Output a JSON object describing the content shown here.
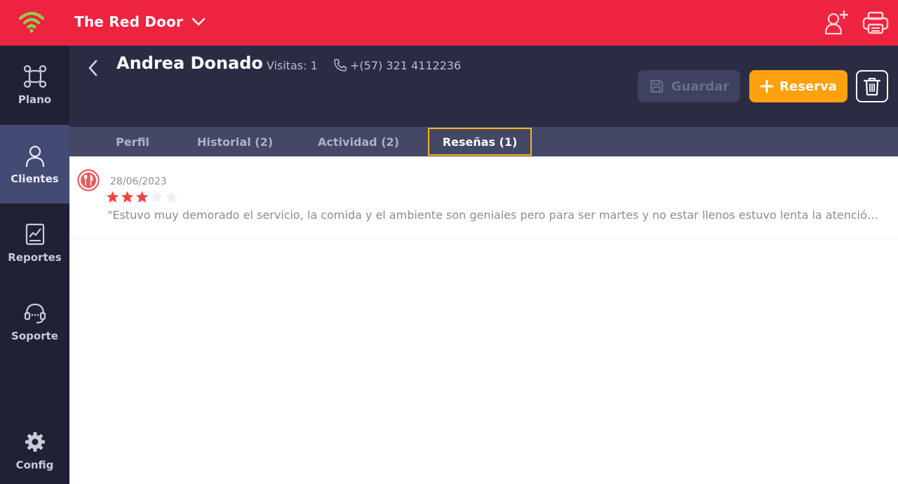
{
  "topbar": {
    "venue_name": "The Red Door",
    "icons": [
      "wifi-icon",
      "chevron-down-icon",
      "add-user-icon",
      "printer-icon"
    ],
    "color": "#ee2340"
  },
  "sidebar": {
    "items": [
      {
        "label": "Plano",
        "icon": "floor-plan-icon"
      },
      {
        "label": "Clientes",
        "icon": "user-icon",
        "active": true
      },
      {
        "label": "Reportes",
        "icon": "report-chart-icon"
      },
      {
        "label": "Soporte",
        "icon": "headset-icon"
      },
      {
        "label": "Config",
        "icon": "gear-icon"
      }
    ]
  },
  "client": {
    "name": "Andrea Donado",
    "visits": "- Visitas: 1",
    "phone": "+(57) 321 4112236"
  },
  "actions": {
    "save_label": "Guardar",
    "reserve_label": "Reserva",
    "reserve_color": "#ffa10e"
  },
  "tabs": [
    {
      "label": "Perfil"
    },
    {
      "label": "Historial (2)"
    },
    {
      "label": "Actividad (2)"
    },
    {
      "label": "Reseñas (1)",
      "active": true
    }
  ],
  "reviews": [
    {
      "date": "28/06/2023",
      "rating": 3,
      "max_rating": 5,
      "text": "\"Estuvo muy demorado el servicio, la comida y el ambiente son geniales pero para ser martes y no estar llenos estuvo lenta la atención\"",
      "star_color": "#f04545"
    }
  ]
}
